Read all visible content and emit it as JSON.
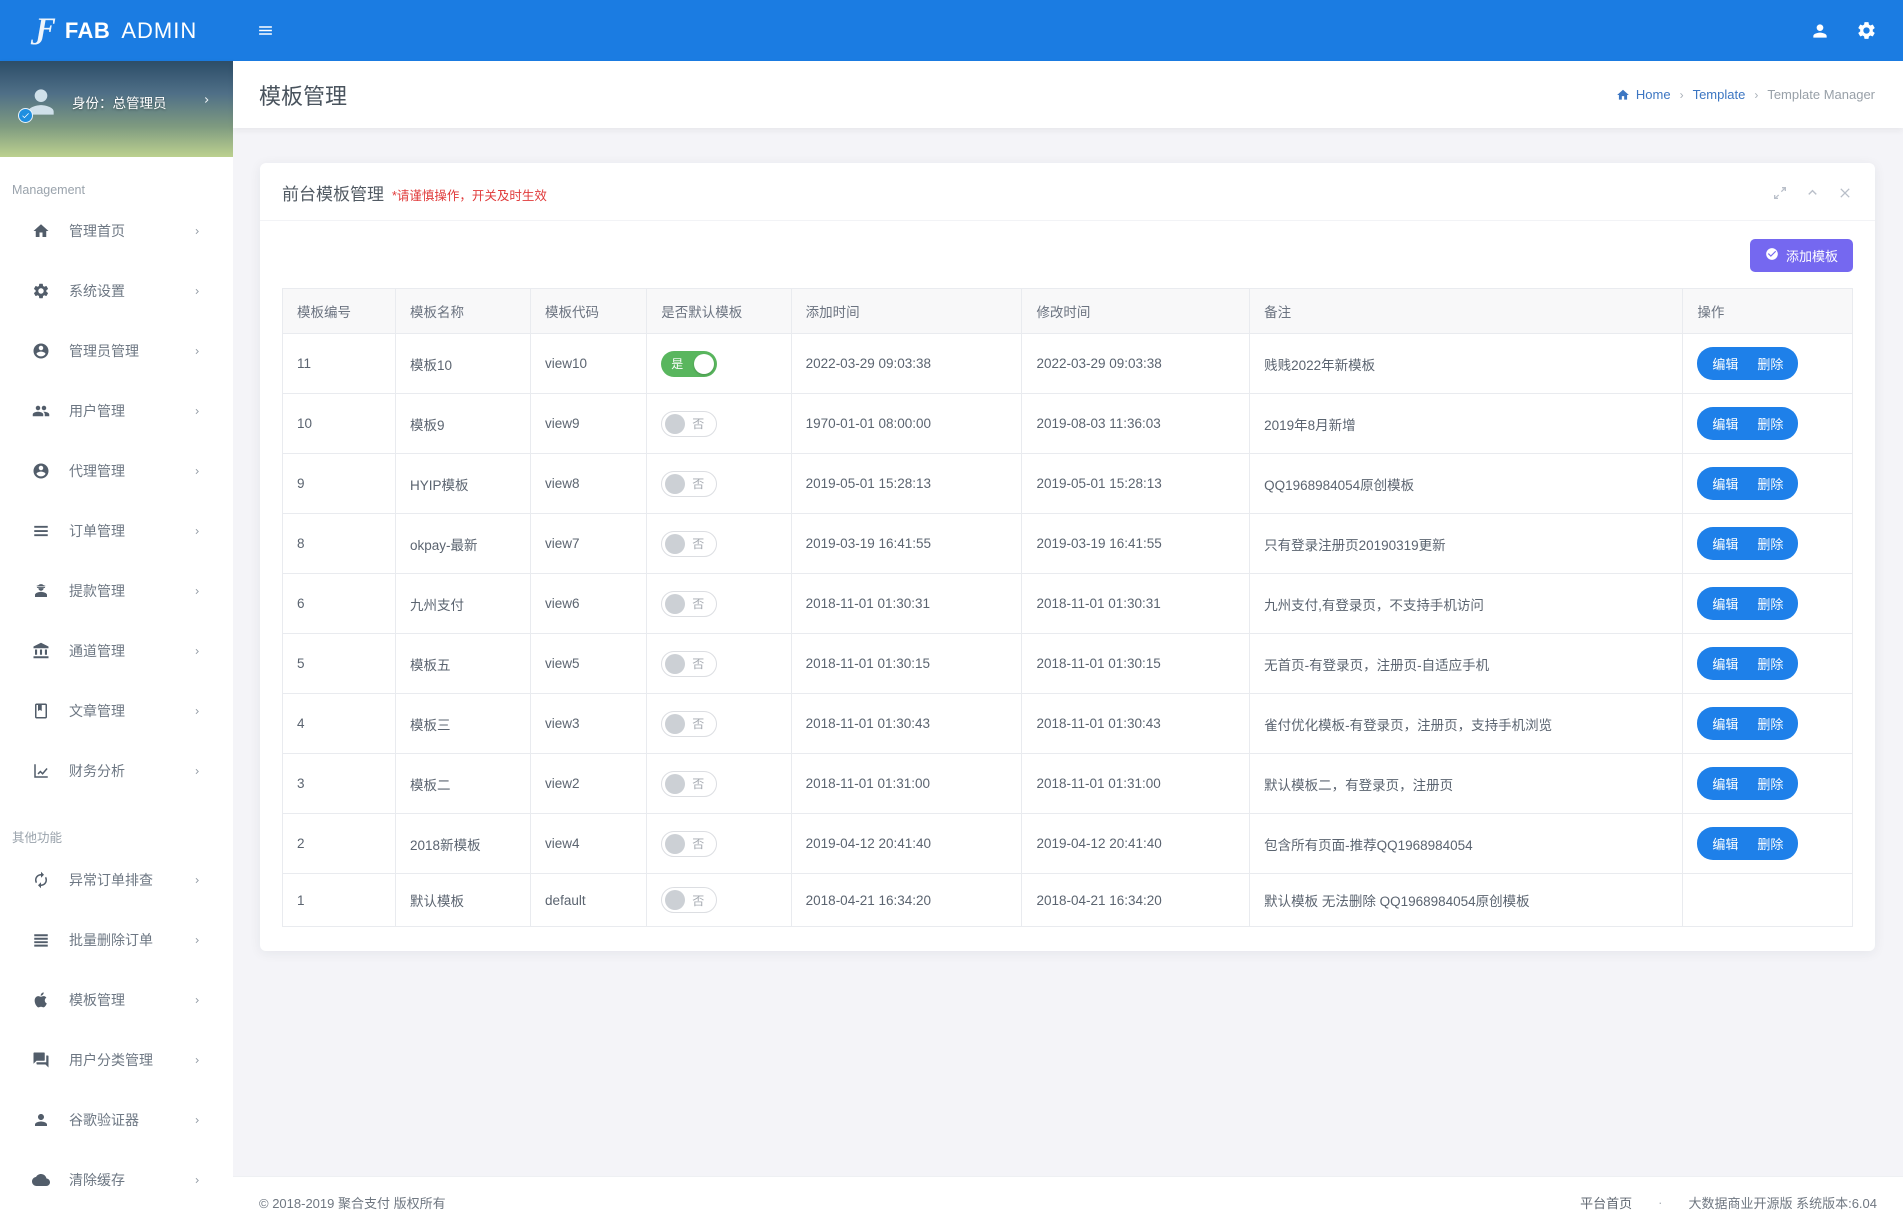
{
  "topbar": {
    "brand_bold": "FAB",
    "brand_light": "ADMIN",
    "icons": [
      "fab-logo-icon",
      "menu-icon",
      "user-icon",
      "gear-icon"
    ]
  },
  "sidebar": {
    "user": {
      "label": "身份：总管理员",
      "avatar_icon": "avatar-person-icon",
      "badge_icon": "badge-check-icon"
    },
    "sections": [
      {
        "label": "Management",
        "items": [
          {
            "name": "sidebar-item-dashboard",
            "icon": "home-icon",
            "label": "管理首页"
          },
          {
            "name": "sidebar-item-settings",
            "icon": "gears-icon",
            "label": "系统设置"
          },
          {
            "name": "sidebar-item-admins",
            "icon": "admin-icon",
            "label": "管理员管理"
          },
          {
            "name": "sidebar-item-users",
            "icon": "users-icon",
            "label": "用户管理"
          },
          {
            "name": "sidebar-item-agents",
            "icon": "agent-icon",
            "label": "代理管理"
          },
          {
            "name": "sidebar-item-orders",
            "icon": "orders-icon",
            "label": "订单管理"
          },
          {
            "name": "sidebar-item-withdrawals",
            "icon": "withdraw-icon",
            "label": "提款管理"
          },
          {
            "name": "sidebar-item-channels",
            "icon": "bank-icon",
            "label": "通道管理"
          },
          {
            "name": "sidebar-item-articles",
            "icon": "article-icon",
            "label": "文章管理"
          },
          {
            "name": "sidebar-item-finance",
            "icon": "chart-icon",
            "label": "财务分析"
          }
        ]
      },
      {
        "label": "其他功能",
        "items": [
          {
            "name": "sidebar-item-abnormal-orders",
            "icon": "sync-icon",
            "label": "异常订单排查"
          },
          {
            "name": "sidebar-item-batch-delete",
            "icon": "batch-delete-icon",
            "label": "批量删除订单"
          },
          {
            "name": "sidebar-item-templates",
            "icon": "apple-icon",
            "label": "模板管理"
          },
          {
            "name": "sidebar-item-user-category",
            "icon": "user-category-icon",
            "label": "用户分类管理"
          },
          {
            "name": "sidebar-item-google-auth",
            "icon": "google-auth-icon",
            "label": "谷歌验证器"
          },
          {
            "name": "sidebar-item-clear-cache",
            "icon": "cache-icon",
            "label": "清除缓存"
          }
        ]
      }
    ]
  },
  "page": {
    "title": "模板管理",
    "breadcrumb": [
      {
        "label": "Home",
        "kind": "link",
        "icon": "breadcrumb-home-icon"
      },
      {
        "label": "Template",
        "kind": "link"
      },
      {
        "label": "Template Manager",
        "kind": "current"
      }
    ]
  },
  "card": {
    "title": "前台模板管理",
    "warning": "*请谨慎操作，开关及时生效",
    "add_button": "添加模板",
    "tool_icons": [
      "expand-icon",
      "chevron-up-icon",
      "close-icon"
    ]
  },
  "table": {
    "columns": [
      "模板编号",
      "模板名称",
      "模板代码",
      "是否默认模板",
      "添加时间",
      "修改时间",
      "备注",
      "操作"
    ],
    "toggle_on_label": "是",
    "toggle_off_label": "否",
    "edit_label": "编辑",
    "delete_label": "删除",
    "rows": [
      {
        "id": "11",
        "name": "模板10",
        "code": "view10",
        "default": true,
        "added": "2022-03-29 09:03:38",
        "modified": "2022-03-29 09:03:38",
        "remark": "贱贱2022年新模板",
        "actions": true
      },
      {
        "id": "10",
        "name": "模板9",
        "code": "view9",
        "default": false,
        "added": "1970-01-01 08:00:00",
        "modified": "2019-08-03 11:36:03",
        "remark": "2019年8月新增",
        "actions": true
      },
      {
        "id": "9",
        "name": "HYIP模板",
        "code": "view8",
        "default": false,
        "added": "2019-05-01 15:28:13",
        "modified": "2019-05-01 15:28:13",
        "remark": "QQ1968984054原创模板",
        "actions": true
      },
      {
        "id": "8",
        "name": "okpay-最新",
        "code": "view7",
        "default": false,
        "added": "2019-03-19 16:41:55",
        "modified": "2019-03-19 16:41:55",
        "remark": "只有登录注册页20190319更新",
        "actions": true
      },
      {
        "id": "6",
        "name": "九州支付",
        "code": "view6",
        "default": false,
        "added": "2018-11-01 01:30:31",
        "modified": "2018-11-01 01:30:31",
        "remark": "九州支付,有登录页，不支持手机访问",
        "actions": true
      },
      {
        "id": "5",
        "name": "模板五",
        "code": "view5",
        "default": false,
        "added": "2018-11-01 01:30:15",
        "modified": "2018-11-01 01:30:15",
        "remark": "无首页-有登录页，注册页-自适应手机",
        "actions": true
      },
      {
        "id": "4",
        "name": "模板三",
        "code": "view3",
        "default": false,
        "added": "2018-11-01 01:30:43",
        "modified": "2018-11-01 01:30:43",
        "remark": "雀付优化模板-有登录页，注册页，支持手机浏览",
        "actions": true
      },
      {
        "id": "3",
        "name": "模板二",
        "code": "view2",
        "default": false,
        "added": "2018-11-01 01:31:00",
        "modified": "2018-11-01 01:31:00",
        "remark": "默认模板二，有登录页，注册页",
        "actions": true
      },
      {
        "id": "2",
        "name": "2018新模板",
        "code": "view4",
        "default": false,
        "added": "2019-04-12 20:41:40",
        "modified": "2019-04-12 20:41:40",
        "remark": "包含所有页面-推荐QQ1968984054",
        "actions": true
      },
      {
        "id": "1",
        "name": "默认模板",
        "code": "default",
        "default": false,
        "added": "2018-04-21 16:34:20",
        "modified": "2018-04-21 16:34:20",
        "remark": "默认模板 无法删除 QQ1968984054原创模板",
        "actions": false
      }
    ]
  },
  "footer": {
    "copyright": "© 2018-2019 聚合支付 版权所有",
    "home_link": "平台首页",
    "dot": "·",
    "version": "大数据商业开源版 系统版本:6.04"
  },
  "colors": {
    "topbar_blue": "#1b7ce2",
    "accent_purple": "#7568f0",
    "button_blue": "#1e80e9",
    "toggle_on_green": "#59b65e",
    "warning_red": "#e03b3b"
  }
}
